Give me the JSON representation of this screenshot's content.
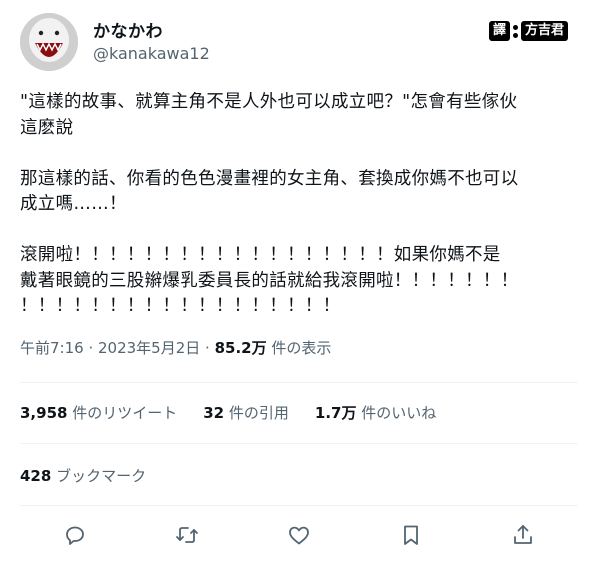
{
  "user": {
    "display_name": "かなかわ",
    "handle": "@kanakawa12"
  },
  "watermark": {
    "left": "譯",
    "right": "方吉君"
  },
  "tweet": {
    "text": "\"這樣的故事、就算主角不是人外也可以成立吧？\"怎會有些傢伙\n這麽說\n\n那這樣的話、你看的色色漫畫裡的女主角、套換成你媽不也可以\n成立嗎……！\n\n滾開啦！！！！！！！！！！！！！！！！！！如果你媽不是\n戴著眼鏡的三股辮爆乳委員長的話就給我滾開啦！！！！！！！\n！！！！！！！！！！！！！！！！！！"
  },
  "meta": {
    "time": "午前7:16",
    "sep": " · ",
    "date": "2023年5月2日",
    "views_count": "85.2万",
    "views_label": " 件の表示"
  },
  "stats": {
    "retweets_count": "3,958",
    "retweets_label": " 件のリツイート",
    "quotes_count": "32",
    "quotes_label": " 件の引用",
    "likes_count": "1.7万",
    "likes_label": " 件のいいね"
  },
  "bookmarks": {
    "count": "428",
    "label": " ブックマーク"
  },
  "icons": [
    "reply-icon",
    "retweet-icon",
    "like-icon",
    "bookmark-icon",
    "share-icon"
  ]
}
